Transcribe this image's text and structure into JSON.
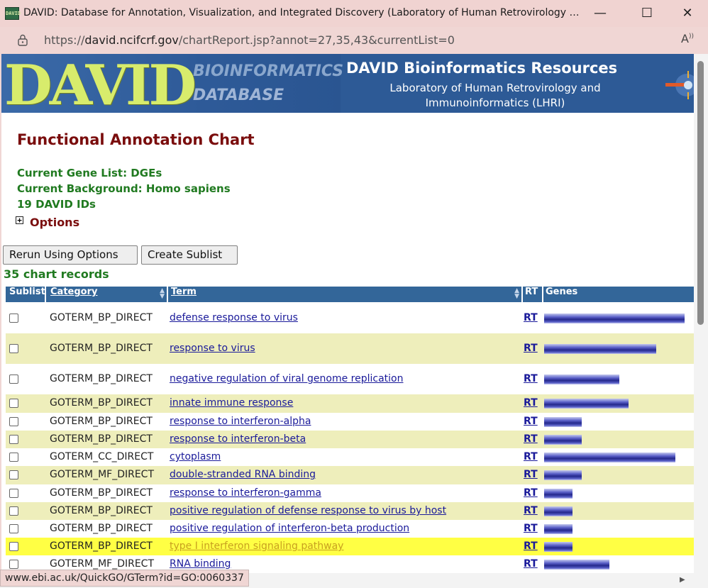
{
  "window": {
    "title": "DAVID: Database for Annotation, Visualization, and Integrated Discovery (Laboratory of Human Retrovirology and Imm...",
    "app_icon": "DAVID"
  },
  "address": {
    "scheme": "https://",
    "host": "david.ncifcrf.gov",
    "path": "/chartReport.jsp?annot=27,35,43&currentList=0"
  },
  "banner": {
    "logo_text": "DAVID",
    "logo_sub1": "BIOINFORMATICS",
    "logo_sub2": "DATABASE",
    "title": "DAVID Bioinformatics Resources",
    "subtitle": "Laboratory of Human Retrovirology and Immunoinformatics (LHRI)"
  },
  "page": {
    "title": "Functional Annotation Chart",
    "gene_list": "Current Gene List: DGEs",
    "background": "Current Background: Homo sapiens",
    "ids": "19 DAVID IDs",
    "options_label": "Options",
    "rerun_button": "Rerun Using Options",
    "sublist_button": "Create Sublist",
    "records": "35 chart records"
  },
  "table": {
    "headers": {
      "sublist": "Sublist",
      "category": "Category",
      "term": "Term",
      "rt": "RT",
      "genes": "Genes"
    },
    "bar_max_genes": 15,
    "bar_color": "#2b2f96",
    "highlight_color": "#ffff44",
    "alt_row_color": "#eeeebb",
    "rows": [
      {
        "category": "GOTERM_BP_DIRECT",
        "term": "defense response to virus",
        "rt": "RT",
        "genes": 15
      },
      {
        "category": "GOTERM_BP_DIRECT",
        "term": "response to virus",
        "rt": "RT",
        "genes": 12
      },
      {
        "category": "GOTERM_BP_DIRECT",
        "term": "negative regulation of viral genome replication",
        "rt": "RT",
        "genes": 8
      },
      {
        "category": "GOTERM_BP_DIRECT",
        "term": "innate immune response",
        "rt": "RT",
        "genes": 9
      },
      {
        "category": "GOTERM_BP_DIRECT",
        "term": "response to interferon-alpha",
        "rt": "RT",
        "genes": 4
      },
      {
        "category": "GOTERM_BP_DIRECT",
        "term": "response to interferon-beta",
        "rt": "RT",
        "genes": 4
      },
      {
        "category": "GOTERM_CC_DIRECT",
        "term": "cytoplasm",
        "rt": "RT",
        "genes": 14
      },
      {
        "category": "GOTERM_MF_DIRECT",
        "term": "double-stranded RNA binding",
        "rt": "RT",
        "genes": 4
      },
      {
        "category": "GOTERM_BP_DIRECT",
        "term": "response to interferon-gamma",
        "rt": "RT",
        "genes": 3
      },
      {
        "category": "GOTERM_BP_DIRECT",
        "term": "positive regulation of defense response to virus by host",
        "rt": "RT",
        "genes": 3
      },
      {
        "category": "GOTERM_BP_DIRECT",
        "term": "positive regulation of interferon-beta production",
        "rt": "RT",
        "genes": 3
      },
      {
        "category": "GOTERM_BP_DIRECT",
        "term": "type I interferon signaling pathway",
        "rt": "RT",
        "genes": 3,
        "highlight": true
      },
      {
        "category": "GOTERM_MF_DIRECT",
        "term": "RNA binding",
        "rt": "RT",
        "genes": 7
      }
    ]
  },
  "status_bar": {
    "text": "www.ebi.ac.uk/QuickGO/GTerm?id=GO:0060337"
  },
  "icons": [
    "app-icon",
    "minimize-icon",
    "maximize-icon",
    "close-icon",
    "lock-icon",
    "read-aloud-icon",
    "expand-icon",
    "sort-icon"
  ]
}
